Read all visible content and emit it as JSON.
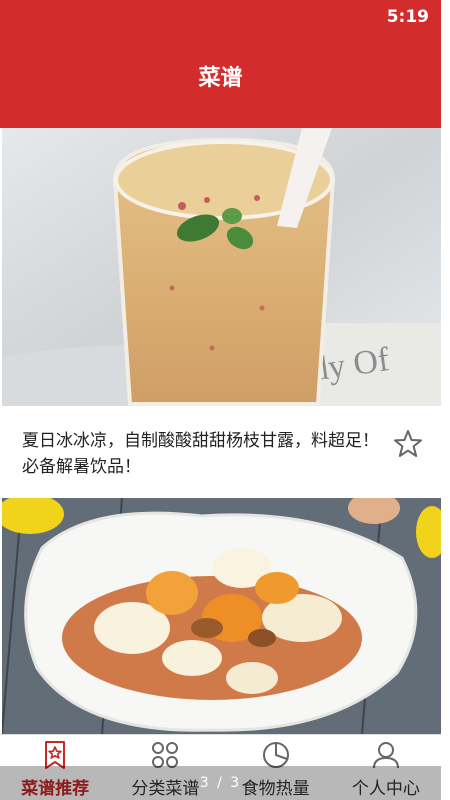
{
  "status_bar": {
    "time": "5:19",
    "color": "#d32c2c"
  },
  "header": {
    "title": "菜谱"
  },
  "feed": {
    "cards": [
      {
        "image_icon": "drink-photo",
        "title": "夏日冰冰凉，自制酸酸甜甜杨枝甘露，料超足！必备解暑饮品！",
        "favorite_icon": "star-outline-icon"
      },
      {
        "image_icon": "egg-dish-photo"
      }
    ]
  },
  "tab_bar": {
    "active_color": "#c62828",
    "tabs": [
      {
        "label": "菜谱推荐",
        "icon": "bookmark-star-icon",
        "active": true
      },
      {
        "label": "分类菜谱",
        "icon": "grid-icon",
        "active": false
      },
      {
        "label": "食物热量",
        "icon": "pie-chart-icon",
        "active": false
      },
      {
        "label": "个人中心",
        "icon": "user-icon",
        "active": false
      }
    ]
  },
  "page_indicator": {
    "text": "3 / 3"
  }
}
